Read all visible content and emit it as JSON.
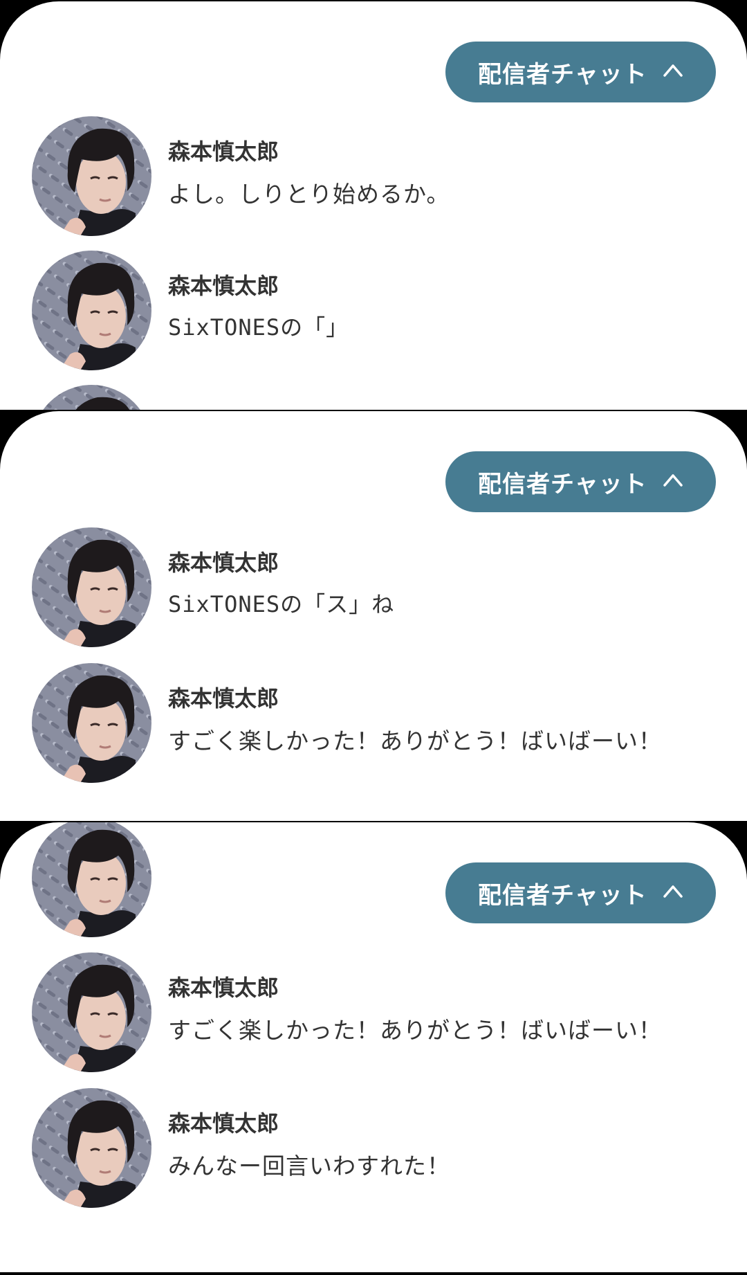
{
  "theme": {
    "accent": "#477c92",
    "text": "#333333",
    "background": "#ffffff"
  },
  "panels": [
    {
      "toggle": {
        "label": "配信者チャット",
        "icon": "chevron-up-icon"
      },
      "messages": [
        {
          "name": "森本慎太郎",
          "text": "よし。しりとり始めるか。"
        },
        {
          "name": "森本慎太郎",
          "text": "SixTONESの「」"
        }
      ]
    },
    {
      "toggle": {
        "label": "配信者チャット",
        "icon": "chevron-up-icon"
      },
      "messages": [
        {
          "name": "森本慎太郎",
          "text": "SixTONESの「ス」ね"
        },
        {
          "name": "森本慎太郎",
          "text": "すごく楽しかった！ありがとう！ばいばーい！"
        }
      ]
    },
    {
      "toggle": {
        "label": "配信者チャット",
        "icon": "chevron-up-icon"
      },
      "messages": [
        {
          "name": "森本慎太郎",
          "text": "すごく楽しかった！ありがとう！ばいばーい！"
        },
        {
          "name": "森本慎太郎",
          "text": "みんなー回言いわすれた！"
        }
      ]
    }
  ]
}
